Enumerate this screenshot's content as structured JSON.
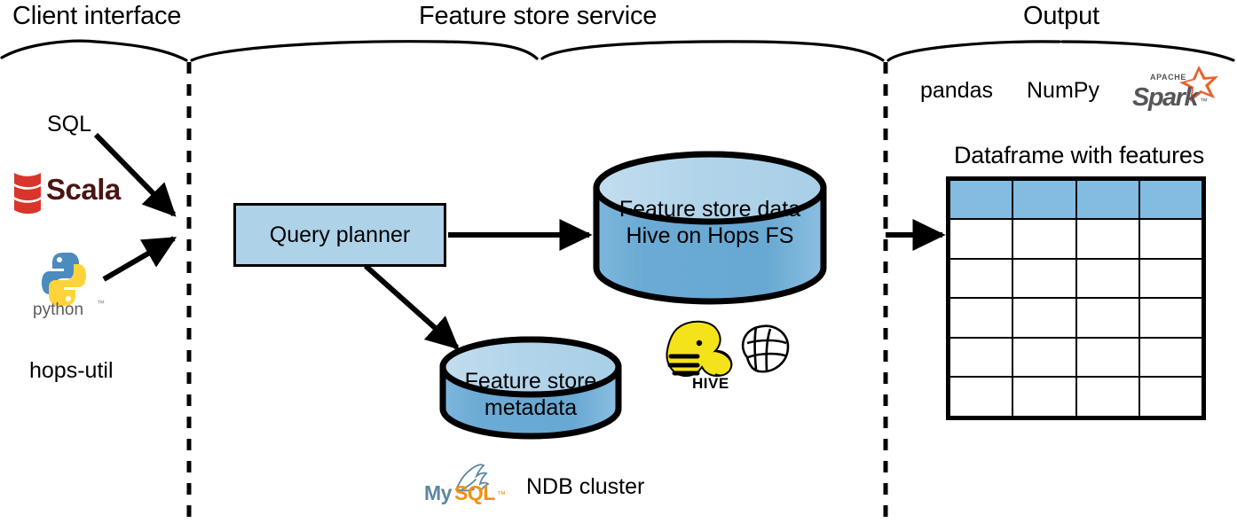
{
  "sections": [
    {
      "id": "client-interface",
      "title": "Client interface"
    },
    {
      "id": "feature-store-service",
      "title": "Feature store service"
    },
    {
      "id": "output",
      "title": "Output"
    }
  ],
  "client": {
    "sql_label": "SQL",
    "scala_label": "Scala",
    "python_label": "python",
    "python_tm": "™",
    "library_label": "hops-util"
  },
  "service": {
    "query_planner_label": "Query planner",
    "feature_store_data": {
      "line1": "Feature store data",
      "line2": "Hive on Hops FS"
    },
    "feature_store_metadata": {
      "line1": "Feature store",
      "line2": "metadata"
    },
    "hive_logo_label": "HIVE",
    "hopsfs_logo_name": "hops-fs-icon",
    "mysql": {
      "part1": "My",
      "part2": "SQL",
      "tm": "™",
      "caption": "NDB cluster"
    }
  },
  "output": {
    "frameworks": [
      "pandas",
      "NumPy"
    ],
    "spark": {
      "apache": "APACHE",
      "name": "Spark",
      "tm": "™"
    },
    "dataframe_caption": "Dataframe with features",
    "table": {
      "columns": 4,
      "header_rows": 1,
      "body_rows": 5,
      "header_cells": [
        "",
        "",
        "",
        ""
      ],
      "body_cells": [
        [
          "",
          "",
          "",
          ""
        ],
        [
          "",
          "",
          "",
          ""
        ],
        [
          "",
          "",
          "",
          ""
        ],
        [
          "",
          "",
          "",
          ""
        ],
        [
          "",
          "",
          "",
          ""
        ]
      ]
    }
  },
  "colors": {
    "box_fill": "#aed2e8",
    "cylinder_top": "#b6d7eb",
    "cylinder_body": "#6aaad4",
    "table_header": "#82bce0",
    "stroke": "#000000",
    "scala_red": "#d9352c",
    "scala_text": "#4a1512",
    "python_blue": "#4b8bbe",
    "python_yellow": "#ffd43b",
    "mysql_blue": "#5d87a1",
    "mysql_orange": "#f29111",
    "spark_orange": "#e8622d",
    "spark_gray": "#56555a",
    "hive_yellow": "#f8e71c"
  }
}
